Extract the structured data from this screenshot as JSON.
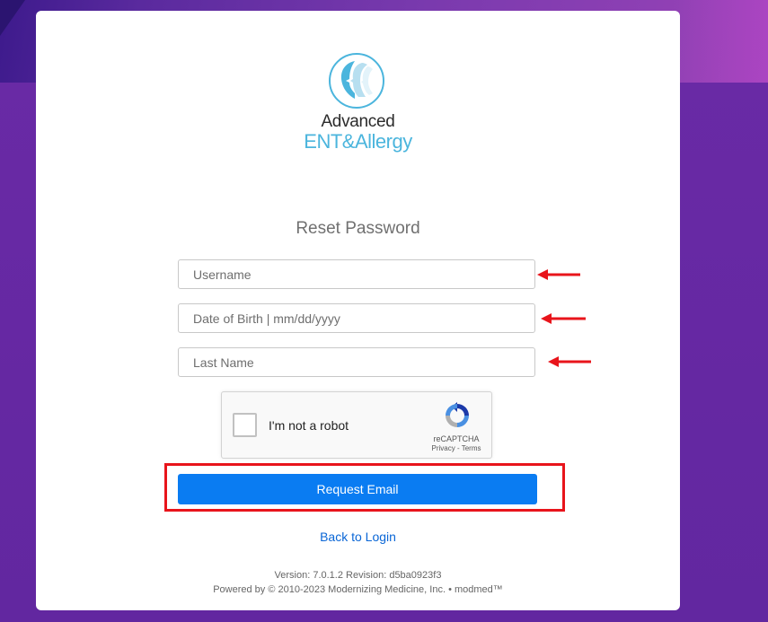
{
  "brand": {
    "line1": "Advanced",
    "line2": "ENT&Allergy",
    "accent": "#4bb5dd"
  },
  "form": {
    "title": "Reset Password",
    "username_placeholder": "Username",
    "dob_placeholder": "Date of Birth | mm/dd/yyyy",
    "lastname_placeholder": "Last Name"
  },
  "captcha": {
    "label": "I'm not a robot",
    "brand": "reCAPTCHA",
    "links": "Privacy - Terms"
  },
  "actions": {
    "request_label": "Request Email",
    "back_label": "Back to Login",
    "primary_color": "#0a7cf2",
    "highlight_color": "#e8141b"
  },
  "footer": {
    "version": "Version: 7.0.1.2 Revision: d5ba0923f3",
    "powered": "Powered by © 2010-2023 Modernizing Medicine, Inc. • modmed™"
  }
}
